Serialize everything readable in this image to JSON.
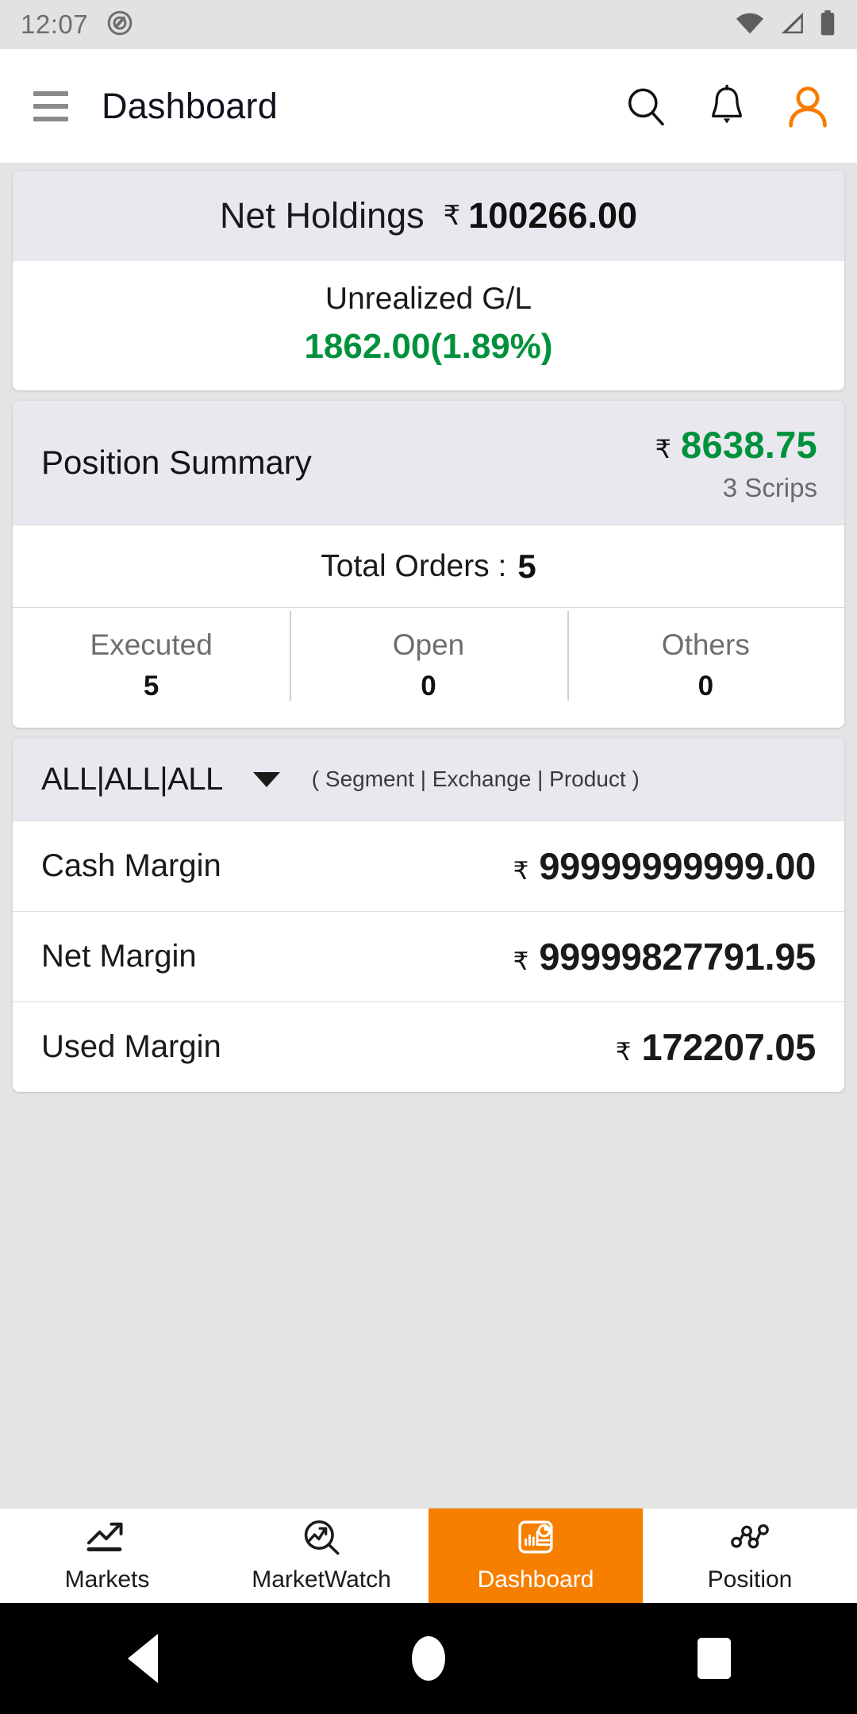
{
  "statusbar": {
    "time": "12:07",
    "icons": [
      "app-notification-icon",
      "wifi-icon",
      "signal-icon",
      "battery-icon"
    ]
  },
  "appbar": {
    "title": "Dashboard",
    "menu_icon": "hamburger-menu-icon",
    "search_icon": "search-icon",
    "notification_icon": "bell-icon",
    "profile_icon": "profile-icon",
    "profile_color": "#F57C00"
  },
  "net_holdings": {
    "label": "Net Holdings",
    "currency": "₹",
    "value": "100266.00",
    "sub_label": "Unrealized G/L",
    "gl_value": "1862.00(1.89%)",
    "gl_color": "#00913C"
  },
  "position_summary": {
    "title": "Position Summary",
    "currency": "₹",
    "amount": "8638.75",
    "amount_color": "#00913C",
    "scrips": "3 Scrips",
    "orders_label": "Total Orders :",
    "orders_value": "5",
    "stats": [
      {
        "label": "Executed",
        "value": "5"
      },
      {
        "label": "Open",
        "value": "0"
      },
      {
        "label": "Others",
        "value": "0"
      }
    ]
  },
  "margin_card": {
    "filter_selected": "ALL|ALL|ALL",
    "filter_hint": "( Segment | Exchange | Product )",
    "rows": [
      {
        "label": "Cash Margin",
        "currency": "₹",
        "value": "99999999999.00"
      },
      {
        "label": "Net Margin",
        "currency": "₹",
        "value": "99999827791.95"
      },
      {
        "label": "Used Margin",
        "currency": "₹",
        "value": "172207.05"
      }
    ]
  },
  "bottom_nav": {
    "active_color": "#F77F00",
    "items": [
      {
        "label": "Markets",
        "icon": "trending-up-icon",
        "active": false
      },
      {
        "label": "MarketWatch",
        "icon": "chart-search-icon",
        "active": false
      },
      {
        "label": "Dashboard",
        "icon": "dashboard-report-icon",
        "active": true
      },
      {
        "label": "Position",
        "icon": "scatter-nodes-icon",
        "active": false
      }
    ]
  },
  "android_nav": {
    "back": "back-button",
    "home": "home-button",
    "recents": "recents-button"
  }
}
